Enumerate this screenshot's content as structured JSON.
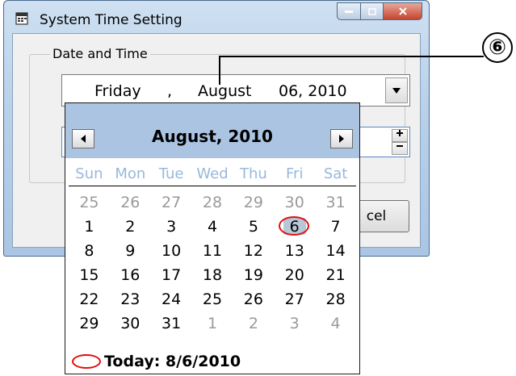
{
  "window": {
    "title": "System Time Setting"
  },
  "group": {
    "label": "Date and Time"
  },
  "date_picker": {
    "weekday": "Friday",
    "separator": ",",
    "month": "August",
    "day_year": "06, 2010"
  },
  "buttons": {
    "cancel_partial": "cel"
  },
  "callout": {
    "number": "⑥"
  },
  "calendar": {
    "month_title": "August, 2010",
    "days_of_week": [
      "Sun",
      "Mon",
      "Tue",
      "Wed",
      "Thu",
      "Fri",
      "Sat"
    ],
    "weeks": [
      [
        "25",
        "26",
        "27",
        "28",
        "29",
        "30",
        "31"
      ],
      [
        "1",
        "2",
        "3",
        "4",
        "5",
        "6",
        "7"
      ],
      [
        "8",
        "9",
        "10",
        "11",
        "12",
        "13",
        "14"
      ],
      [
        "15",
        "16",
        "17",
        "18",
        "19",
        "20",
        "21"
      ],
      [
        "22",
        "23",
        "24",
        "25",
        "26",
        "27",
        "28"
      ],
      [
        "29",
        "30",
        "31",
        "1",
        "2",
        "3",
        "4"
      ]
    ],
    "other_month_flags": [
      [
        true,
        true,
        true,
        true,
        true,
        true,
        true
      ],
      [
        false,
        false,
        false,
        false,
        false,
        false,
        false
      ],
      [
        false,
        false,
        false,
        false,
        false,
        false,
        false
      ],
      [
        false,
        false,
        false,
        false,
        false,
        false,
        false
      ],
      [
        false,
        false,
        false,
        false,
        false,
        false,
        false
      ],
      [
        false,
        false,
        false,
        true,
        true,
        true,
        true
      ]
    ],
    "selected_day": "6",
    "today_label": "Today: 8/6/2010"
  },
  "colors": {
    "highlight_ring": "#e01010",
    "header_bg": "#abc4e2",
    "dow_text": "#98b8dc"
  }
}
